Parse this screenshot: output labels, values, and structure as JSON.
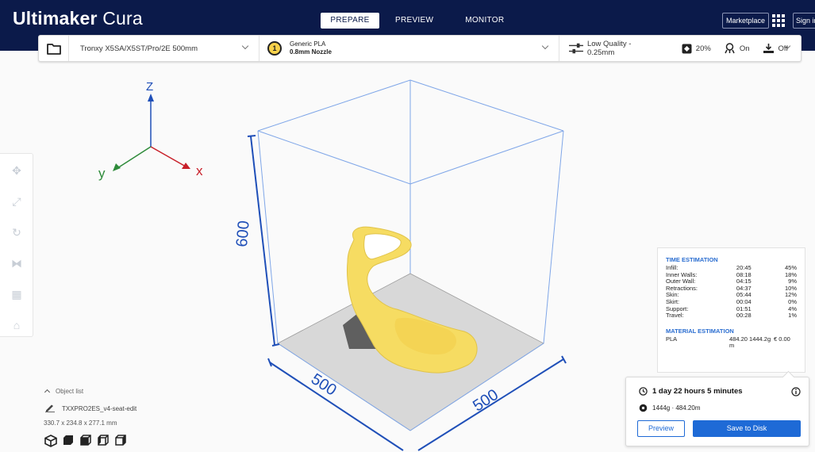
{
  "app": {
    "title_bold": "Ultimaker",
    "title_light": " Cura"
  },
  "stages": [
    {
      "label": "PREPARE",
      "active": true
    },
    {
      "label": "PREVIEW",
      "active": false
    },
    {
      "label": "MONITOR",
      "active": false
    }
  ],
  "header": {
    "marketplace_label": "Marketplace",
    "signin_label": "Sign in"
  },
  "settings_bar": {
    "printer": "Tronxy X5SA/X5ST/Pro/2E 500mm",
    "extruder_number": "1",
    "material_name": "Generic PLA",
    "nozzle": "0.8mm Nozzle",
    "quality": "Low Quality - 0.25mm",
    "infill": "20%",
    "support": "On",
    "adhesion": "Off"
  },
  "viewport": {
    "axis_z": "Z",
    "axis_y": "y",
    "axis_x": "x",
    "dim_height": "600",
    "dim_width": "500",
    "dim_depth": "500"
  },
  "object_list": {
    "header": "Object list",
    "file_name": "TXXPRO2ES_v4-seat-edit",
    "dimensions": "330.7 x 234.8 x 277.1 mm"
  },
  "time_estimation": {
    "title": "TIME ESTIMATION",
    "rows": [
      {
        "label": "Infill:",
        "time": "20:45",
        "percent": "45%"
      },
      {
        "label": "Inner Walls:",
        "time": "08:18",
        "percent": "18%"
      },
      {
        "label": "Outer Wall:",
        "time": "04:15",
        "percent": "9%"
      },
      {
        "label": "Retractions:",
        "time": "04:37",
        "percent": "10%"
      },
      {
        "label": "Skin:",
        "time": "05:44",
        "percent": "12%"
      },
      {
        "label": "Skirt:",
        "time": "00:04",
        "percent": "0%"
      },
      {
        "label": "Support:",
        "time": "01:51",
        "percent": "4%"
      },
      {
        "label": "Travel:",
        "time": "00:28",
        "percent": "1%"
      }
    ]
  },
  "material_estimation": {
    "title": "MATERIAL ESTIMATION",
    "material": "PLA",
    "length_weight": "484.20 1444.2g",
    "cost": "€ 0.00",
    "unit": "m"
  },
  "action_panel": {
    "print_time": "1 day 22 hours 5 minutes",
    "material_summary": "1444g · 484.20m",
    "preview_label": "Preview",
    "save_label": "Save to Disk"
  },
  "colors": {
    "header_bg": "#0b1a4a",
    "accent_blue": "#1e6ad6",
    "model_yellow": "#f6dc62",
    "axis_z": "#1f4fb8",
    "axis_x": "#c8202a",
    "axis_y": "#2e8b3a"
  }
}
